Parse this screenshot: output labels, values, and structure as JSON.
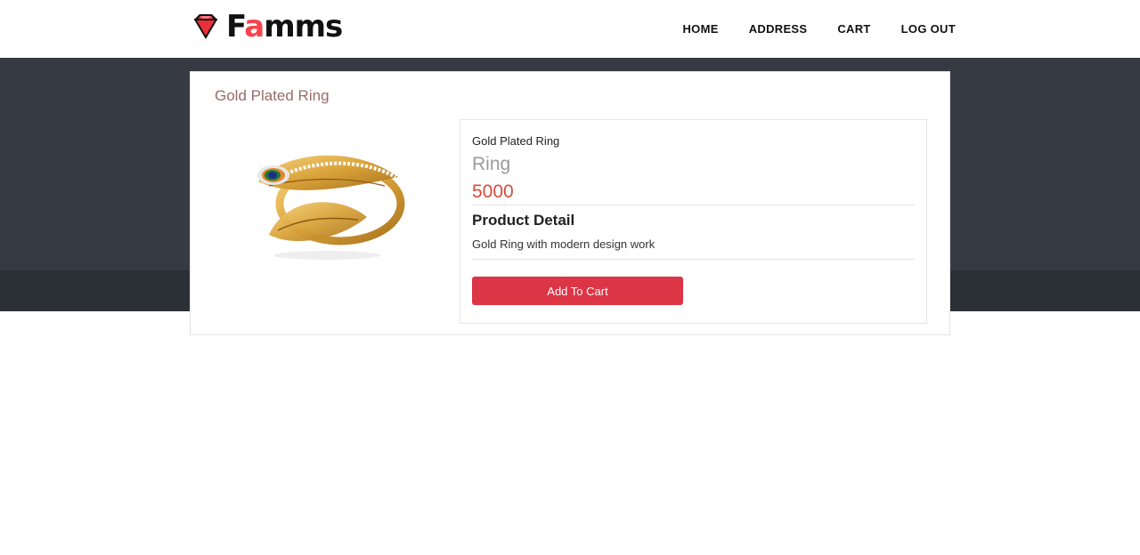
{
  "brand": {
    "prefix": "F",
    "accent": "a",
    "suffix": "mms",
    "accent_color": "#f7444e"
  },
  "nav": {
    "items": [
      {
        "label": "HOME"
      },
      {
        "label": "ADDRESS"
      },
      {
        "label": "CART"
      },
      {
        "label": "LOG OUT"
      }
    ]
  },
  "product": {
    "title": "Gold Plated Ring",
    "name": "Gold Plated Ring",
    "category": "Ring",
    "price": "5000",
    "detail_heading": "Product Detail",
    "description": "Gold Ring with modern design work",
    "add_button": "Add To Cart",
    "button_color": "#dc3545"
  },
  "icons": {
    "logo": "diamond-icon"
  }
}
